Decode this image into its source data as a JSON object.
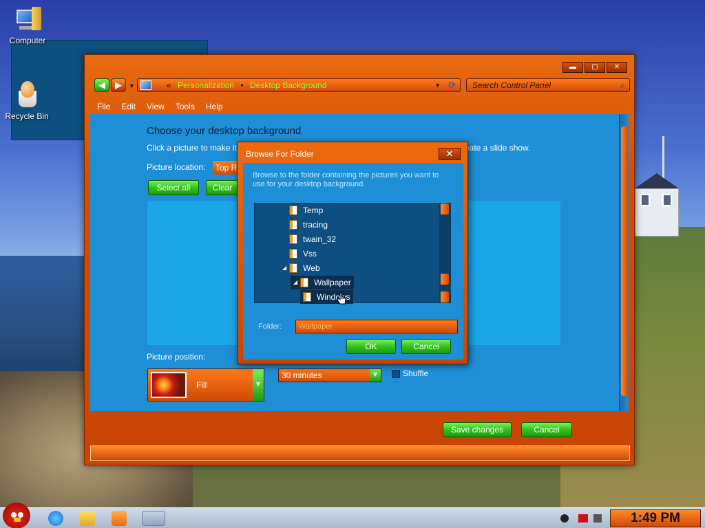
{
  "desktop": {
    "icons": [
      {
        "label": "Computer"
      },
      {
        "label": "Recycle Bin"
      }
    ]
  },
  "window": {
    "address": {
      "sep1": "«",
      "crumb1": "Personalization",
      "sep2": "•",
      "crumb2": "Desktop Background"
    },
    "search_placeholder": "Search Control Panel",
    "caption": {
      "minimize": "▬",
      "maximize": "▢",
      "close": "✕"
    },
    "menu": [
      "File",
      "Edit",
      "View",
      "Tools",
      "Help"
    ],
    "content": {
      "title": "Choose your desktop background",
      "subtitle": "Click a picture to make it",
      "subtitle_tail": "reate a slide show.",
      "picture_location_label": "Picture location:",
      "picture_location_value": "Top R",
      "select_all": "Select all",
      "clear_all": "Clear",
      "picture_position_label": "Picture position:",
      "picture_position_value": "Fill",
      "interval_value": "30 minutes",
      "shuffle_label": "Shuffle"
    },
    "footer": {
      "save": "Save changes",
      "cancel": "Cancel"
    }
  },
  "dialog": {
    "title": "Browse For Folder",
    "close": "✕",
    "description": "Browse to the folder containing the pictures you want to use for your desktop background.",
    "tree": [
      {
        "label": "Temp"
      },
      {
        "label": "tracing"
      },
      {
        "label": "twain_32"
      },
      {
        "label": "Vss"
      },
      {
        "label": "Web"
      },
      {
        "label": "Wallpaper"
      },
      {
        "label": "Windows"
      }
    ],
    "folder_label": "Folder:",
    "folder_value": "Wallpaper",
    "ok": "OK",
    "cancel": "Cancel"
  },
  "taskbar": {
    "clock": "1:49 PM"
  },
  "colors": {
    "frame_orange": "#d44e06",
    "content_blue": "#1e8fd6",
    "button_green": "#30c21c",
    "breadcrumb_green": "#9cff2a"
  }
}
